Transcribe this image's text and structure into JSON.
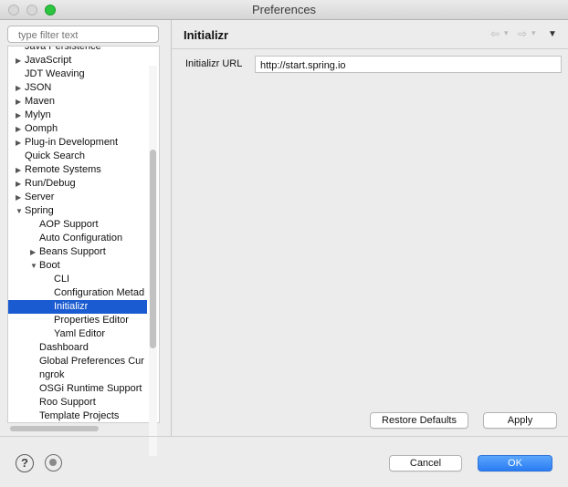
{
  "window": {
    "title": "Preferences"
  },
  "filter": {
    "placeholder": "type filter text"
  },
  "tree": [
    {
      "label": "Java Persistence",
      "depth": 1,
      "twisty": ""
    },
    {
      "label": "JavaScript",
      "depth": 1,
      "twisty": "collapsed"
    },
    {
      "label": "JDT Weaving",
      "depth": 1,
      "twisty": ""
    },
    {
      "label": "JSON",
      "depth": 1,
      "twisty": "collapsed"
    },
    {
      "label": "Maven",
      "depth": 1,
      "twisty": "collapsed"
    },
    {
      "label": "Mylyn",
      "depth": 1,
      "twisty": "collapsed"
    },
    {
      "label": "Oomph",
      "depth": 1,
      "twisty": "collapsed"
    },
    {
      "label": "Plug-in Development",
      "depth": 1,
      "twisty": "collapsed"
    },
    {
      "label": "Quick Search",
      "depth": 1,
      "twisty": ""
    },
    {
      "label": "Remote Systems",
      "depth": 1,
      "twisty": "collapsed"
    },
    {
      "label": "Run/Debug",
      "depth": 1,
      "twisty": "collapsed"
    },
    {
      "label": "Server",
      "depth": 1,
      "twisty": "collapsed"
    },
    {
      "label": "Spring",
      "depth": 1,
      "twisty": "expanded"
    },
    {
      "label": "AOP Support",
      "depth": 2,
      "twisty": ""
    },
    {
      "label": "Auto Configuration",
      "depth": 2,
      "twisty": ""
    },
    {
      "label": "Beans Support",
      "depth": 2,
      "twisty": "collapsed"
    },
    {
      "label": "Boot",
      "depth": 2,
      "twisty": "expanded"
    },
    {
      "label": "CLI",
      "depth": 3,
      "twisty": ""
    },
    {
      "label": "Configuration Metad",
      "depth": 3,
      "twisty": ""
    },
    {
      "label": "Initializr",
      "depth": 3,
      "twisty": "",
      "selected": true
    },
    {
      "label": "Properties Editor",
      "depth": 3,
      "twisty": ""
    },
    {
      "label": "Yaml Editor",
      "depth": 3,
      "twisty": ""
    },
    {
      "label": "Dashboard",
      "depth": 2,
      "twisty": ""
    },
    {
      "label": "Global Preferences Cur",
      "depth": 2,
      "twisty": ""
    },
    {
      "label": "ngrok",
      "depth": 2,
      "twisty": ""
    },
    {
      "label": "OSGi Runtime Support",
      "depth": 2,
      "twisty": ""
    },
    {
      "label": "Roo Support",
      "depth": 2,
      "twisty": ""
    },
    {
      "label": "Template Projects",
      "depth": 2,
      "twisty": ""
    }
  ],
  "page": {
    "title": "Initializr",
    "url_label": "Initializr URL",
    "url_value": "http://start.spring.io"
  },
  "nav": {
    "back_icon": "⇦",
    "forward_icon": "⇨",
    "chevron_icon": "▾",
    "menu_icon": "▼"
  },
  "buttons": {
    "restore_defaults": "Restore Defaults",
    "apply": "Apply",
    "cancel": "Cancel",
    "ok": "OK"
  },
  "footer": {
    "help_icon": "?"
  }
}
